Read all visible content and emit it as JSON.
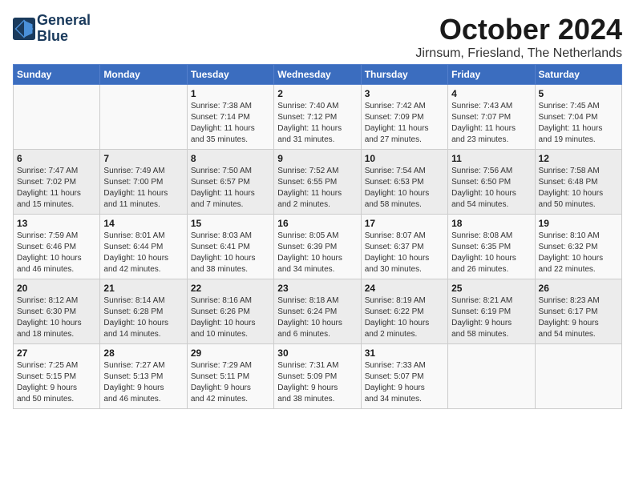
{
  "logo": {
    "line1": "General",
    "line2": "Blue"
  },
  "title": "October 2024",
  "subtitle": "Jirnsum, Friesland, The Netherlands",
  "headers": [
    "Sunday",
    "Monday",
    "Tuesday",
    "Wednesday",
    "Thursday",
    "Friday",
    "Saturday"
  ],
  "weeks": [
    [
      {
        "day": "",
        "info": ""
      },
      {
        "day": "",
        "info": ""
      },
      {
        "day": "1",
        "info": "Sunrise: 7:38 AM\nSunset: 7:14 PM\nDaylight: 11 hours\nand 35 minutes."
      },
      {
        "day": "2",
        "info": "Sunrise: 7:40 AM\nSunset: 7:12 PM\nDaylight: 11 hours\nand 31 minutes."
      },
      {
        "day": "3",
        "info": "Sunrise: 7:42 AM\nSunset: 7:09 PM\nDaylight: 11 hours\nand 27 minutes."
      },
      {
        "day": "4",
        "info": "Sunrise: 7:43 AM\nSunset: 7:07 PM\nDaylight: 11 hours\nand 23 minutes."
      },
      {
        "day": "5",
        "info": "Sunrise: 7:45 AM\nSunset: 7:04 PM\nDaylight: 11 hours\nand 19 minutes."
      }
    ],
    [
      {
        "day": "6",
        "info": "Sunrise: 7:47 AM\nSunset: 7:02 PM\nDaylight: 11 hours\nand 15 minutes."
      },
      {
        "day": "7",
        "info": "Sunrise: 7:49 AM\nSunset: 7:00 PM\nDaylight: 11 hours\nand 11 minutes."
      },
      {
        "day": "8",
        "info": "Sunrise: 7:50 AM\nSunset: 6:57 PM\nDaylight: 11 hours\nand 7 minutes."
      },
      {
        "day": "9",
        "info": "Sunrise: 7:52 AM\nSunset: 6:55 PM\nDaylight: 11 hours\nand 2 minutes."
      },
      {
        "day": "10",
        "info": "Sunrise: 7:54 AM\nSunset: 6:53 PM\nDaylight: 10 hours\nand 58 minutes."
      },
      {
        "day": "11",
        "info": "Sunrise: 7:56 AM\nSunset: 6:50 PM\nDaylight: 10 hours\nand 54 minutes."
      },
      {
        "day": "12",
        "info": "Sunrise: 7:58 AM\nSunset: 6:48 PM\nDaylight: 10 hours\nand 50 minutes."
      }
    ],
    [
      {
        "day": "13",
        "info": "Sunrise: 7:59 AM\nSunset: 6:46 PM\nDaylight: 10 hours\nand 46 minutes."
      },
      {
        "day": "14",
        "info": "Sunrise: 8:01 AM\nSunset: 6:44 PM\nDaylight: 10 hours\nand 42 minutes."
      },
      {
        "day": "15",
        "info": "Sunrise: 8:03 AM\nSunset: 6:41 PM\nDaylight: 10 hours\nand 38 minutes."
      },
      {
        "day": "16",
        "info": "Sunrise: 8:05 AM\nSunset: 6:39 PM\nDaylight: 10 hours\nand 34 minutes."
      },
      {
        "day": "17",
        "info": "Sunrise: 8:07 AM\nSunset: 6:37 PM\nDaylight: 10 hours\nand 30 minutes."
      },
      {
        "day": "18",
        "info": "Sunrise: 8:08 AM\nSunset: 6:35 PM\nDaylight: 10 hours\nand 26 minutes."
      },
      {
        "day": "19",
        "info": "Sunrise: 8:10 AM\nSunset: 6:32 PM\nDaylight: 10 hours\nand 22 minutes."
      }
    ],
    [
      {
        "day": "20",
        "info": "Sunrise: 8:12 AM\nSunset: 6:30 PM\nDaylight: 10 hours\nand 18 minutes."
      },
      {
        "day": "21",
        "info": "Sunrise: 8:14 AM\nSunset: 6:28 PM\nDaylight: 10 hours\nand 14 minutes."
      },
      {
        "day": "22",
        "info": "Sunrise: 8:16 AM\nSunset: 6:26 PM\nDaylight: 10 hours\nand 10 minutes."
      },
      {
        "day": "23",
        "info": "Sunrise: 8:18 AM\nSunset: 6:24 PM\nDaylight: 10 hours\nand 6 minutes."
      },
      {
        "day": "24",
        "info": "Sunrise: 8:19 AM\nSunset: 6:22 PM\nDaylight: 10 hours\nand 2 minutes."
      },
      {
        "day": "25",
        "info": "Sunrise: 8:21 AM\nSunset: 6:19 PM\nDaylight: 9 hours\nand 58 minutes."
      },
      {
        "day": "26",
        "info": "Sunrise: 8:23 AM\nSunset: 6:17 PM\nDaylight: 9 hours\nand 54 minutes."
      }
    ],
    [
      {
        "day": "27",
        "info": "Sunrise: 7:25 AM\nSunset: 5:15 PM\nDaylight: 9 hours\nand 50 minutes."
      },
      {
        "day": "28",
        "info": "Sunrise: 7:27 AM\nSunset: 5:13 PM\nDaylight: 9 hours\nand 46 minutes."
      },
      {
        "day": "29",
        "info": "Sunrise: 7:29 AM\nSunset: 5:11 PM\nDaylight: 9 hours\nand 42 minutes."
      },
      {
        "day": "30",
        "info": "Sunrise: 7:31 AM\nSunset: 5:09 PM\nDaylight: 9 hours\nand 38 minutes."
      },
      {
        "day": "31",
        "info": "Sunrise: 7:33 AM\nSunset: 5:07 PM\nDaylight: 9 hours\nand 34 minutes."
      },
      {
        "day": "",
        "info": ""
      },
      {
        "day": "",
        "info": ""
      }
    ]
  ]
}
